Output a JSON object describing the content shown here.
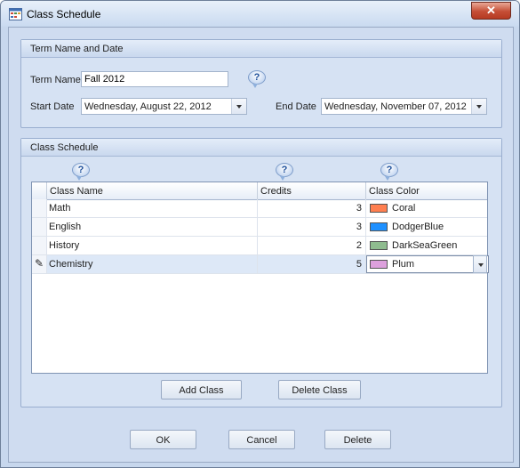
{
  "window": {
    "title": "Class Schedule",
    "close_glyph": "✕"
  },
  "term_group": {
    "title": "Term Name and Date",
    "term_name_label": "Term Name",
    "term_name_value": "Fall 2012",
    "start_date_label": "Start Date",
    "start_date_value": "Wednesday, August 22, 2012",
    "end_date_label": "End Date",
    "end_date_value": "Wednesday, November 07, 2012",
    "help_glyph": "?"
  },
  "schedule_group": {
    "title": "Class Schedule",
    "help_glyph": "?",
    "columns": [
      "Class Name",
      "Credits",
      "Class Color"
    ],
    "rows": [
      {
        "name": "Math",
        "credits": "3",
        "color_name": "Coral",
        "color_hex": "#FF7F50"
      },
      {
        "name": "English",
        "credits": "3",
        "color_name": "DodgerBlue",
        "color_hex": "#1E90FF"
      },
      {
        "name": "History",
        "credits": "2",
        "color_name": "DarkSeaGreen",
        "color_hex": "#8FBC8F"
      },
      {
        "name": "Chemistry",
        "credits": "5",
        "color_name": "Plum",
        "color_hex": "#DDA0DD"
      }
    ],
    "edit_indicator": "✎",
    "add_button": "Add Class",
    "delete_button": "Delete Class"
  },
  "footer": {
    "ok": "OK",
    "cancel": "Cancel",
    "delete": "Delete"
  },
  "icons": {
    "app": "calendar-icon",
    "close": "close-icon",
    "help": "help-bubble-icon",
    "pencil": "pencil-icon",
    "dropdown": "chevron-down-icon"
  },
  "colors": {
    "accent": "#c7d7ed",
    "close_button": "#c54e36"
  }
}
